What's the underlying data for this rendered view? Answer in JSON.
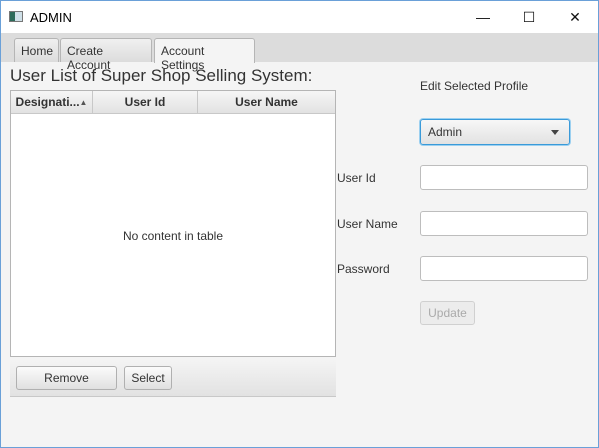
{
  "window": {
    "title": "ADMIN",
    "minimize": "—",
    "maximize": "☐",
    "close": "✕"
  },
  "tabs": [
    {
      "label": "Home"
    },
    {
      "label": "Create Account"
    },
    {
      "label": "Account Settings",
      "selected": true
    }
  ],
  "list": {
    "heading": "User List of Super Shop  Selling System:",
    "columns": [
      {
        "label": "Designati...",
        "sort": "ascending"
      },
      {
        "label": "User Id"
      },
      {
        "label": "User Name"
      }
    ],
    "sort_indicator": "▲",
    "empty_text": "No content in table",
    "remove_label": "Remove",
    "select_label": "Select"
  },
  "profile": {
    "title": "Edit Selected Profile",
    "designation": "Admin",
    "user_id_label": "User Id",
    "user_id_value": "",
    "user_name_label": "User Name",
    "user_name_value": "",
    "password_label": "Password",
    "password_value": "",
    "update_label": "Update"
  },
  "colors": {
    "focus": "#3a9ad9",
    "titlebar": "#ffffff",
    "background": "#f4f4f4"
  }
}
